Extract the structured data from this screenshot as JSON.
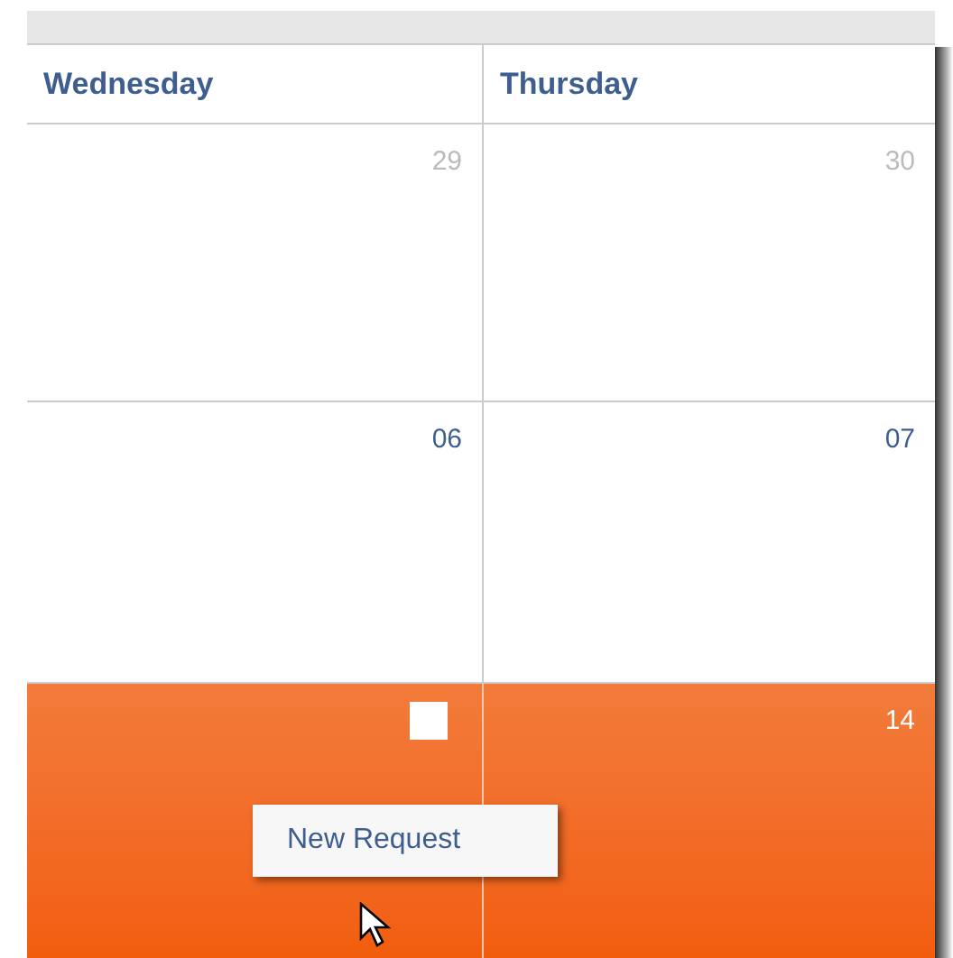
{
  "columns": [
    "Wednesday",
    "Thursday"
  ],
  "weeks": [
    {
      "selected": false,
      "days": [
        {
          "kind": "date",
          "label": "29",
          "muted": true
        },
        {
          "kind": "date",
          "label": "30",
          "muted": true
        }
      ]
    },
    {
      "selected": false,
      "days": [
        {
          "kind": "date",
          "label": "06",
          "muted": false
        },
        {
          "kind": "date",
          "label": "07",
          "muted": false
        }
      ]
    },
    {
      "selected": true,
      "days": [
        {
          "kind": "marker"
        },
        {
          "kind": "date",
          "label": "14",
          "muted": false
        }
      ]
    }
  ],
  "context_menu": {
    "items": [
      "New Request"
    ]
  }
}
